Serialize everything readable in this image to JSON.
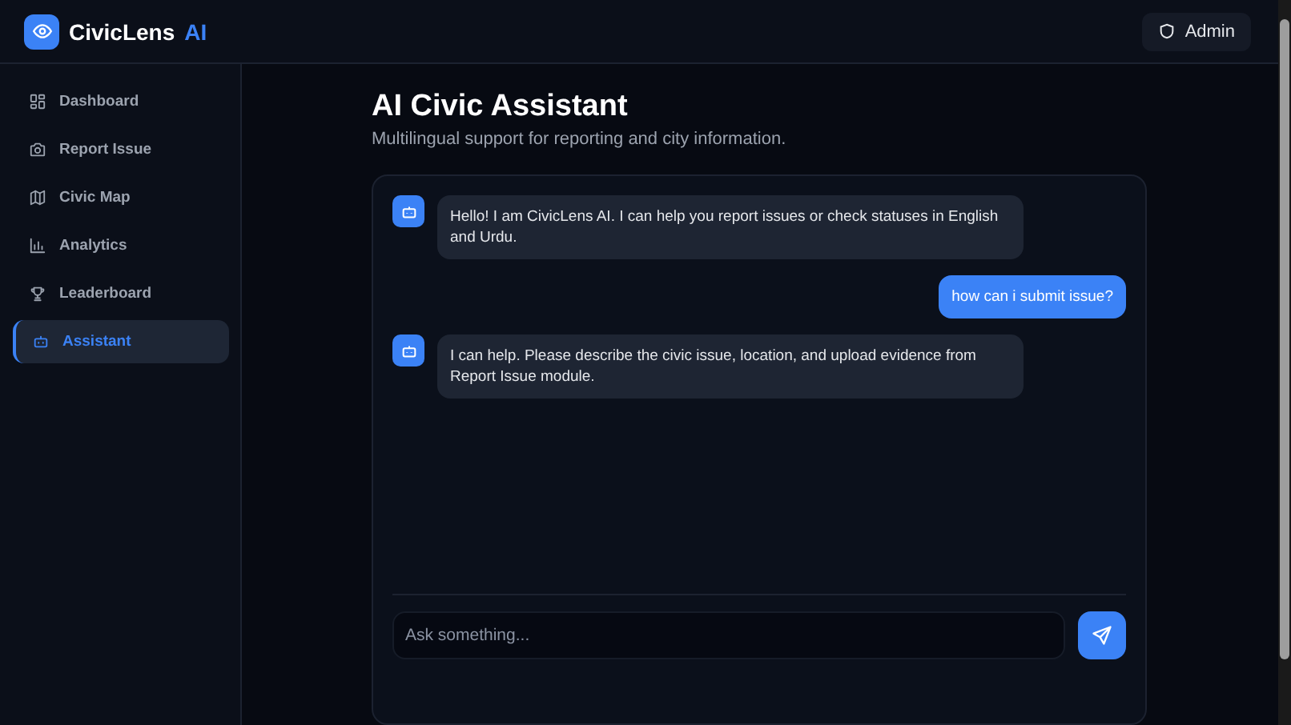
{
  "header": {
    "logo": "CivicLens",
    "logo_accent": "AI",
    "user_button": "Admin"
  },
  "sidebar": {
    "items": [
      {
        "label": "Dashboard",
        "selected": false
      },
      {
        "label": "Report Issue",
        "selected": false
      },
      {
        "label": "Civic Map",
        "selected": false
      },
      {
        "label": "Analytics",
        "selected": false
      },
      {
        "label": "Leaderboard",
        "selected": false
      },
      {
        "label": "Assistant",
        "selected": true
      }
    ]
  },
  "page": {
    "title": "AI Civic Assistant",
    "subtitle": "Multilingual support for reporting and city information."
  },
  "chat": {
    "messages": [
      {
        "kind": "bot",
        "text": "Hello! I am CivicLens AI. I can help you report issues or check statuses in English and Urdu."
      },
      {
        "kind": "user",
        "text": "how can i submit issue?"
      },
      {
        "kind": "bot",
        "text": "I can help. Please describe the civic issue, location, and upload evidence from Report Issue module."
      }
    ],
    "input": {
      "placeholder": "Ask something..."
    }
  }
}
